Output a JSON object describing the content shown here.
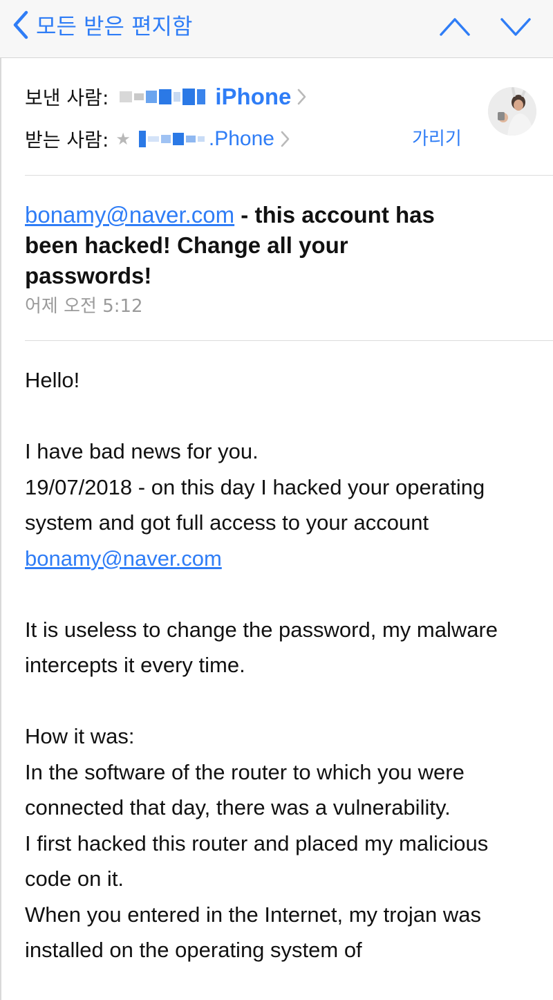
{
  "nav": {
    "back_label": "모든 받은 편지함"
  },
  "header": {
    "from_label": "보낸 사람:",
    "from_name": "iPhone",
    "to_label": "받는 사람:",
    "to_name": ".Phone",
    "hide_label": "가리기"
  },
  "subject": {
    "email": "bonamy@naver.com",
    "text": " - this account has been hacked! Change all your passwords!"
  },
  "date": "어제 오전 5:12",
  "body": {
    "greeting": "Hello!",
    "line1": "I have bad news for you.",
    "line2": "19/07/2018 - on this day I hacked your operating system and got full access to your account ",
    "line2_email": "bonamy@naver.com",
    "para2": "It is useless to change the password, my malware intercepts it every time.",
    "para3_1": "How it was:",
    "para3_2": "In the software of the router to which you were connected that day, there was a vulnerability.",
    "para3_3": "I first hacked this router and placed my malicious code on it.",
    "para3_4": "When you entered in the Internet, my trojan was installed on the operating system of"
  },
  "colors": {
    "accent": "#2f7df6",
    "muted": "#9a9a9a",
    "navbar_bg": "#f7f7f7"
  }
}
